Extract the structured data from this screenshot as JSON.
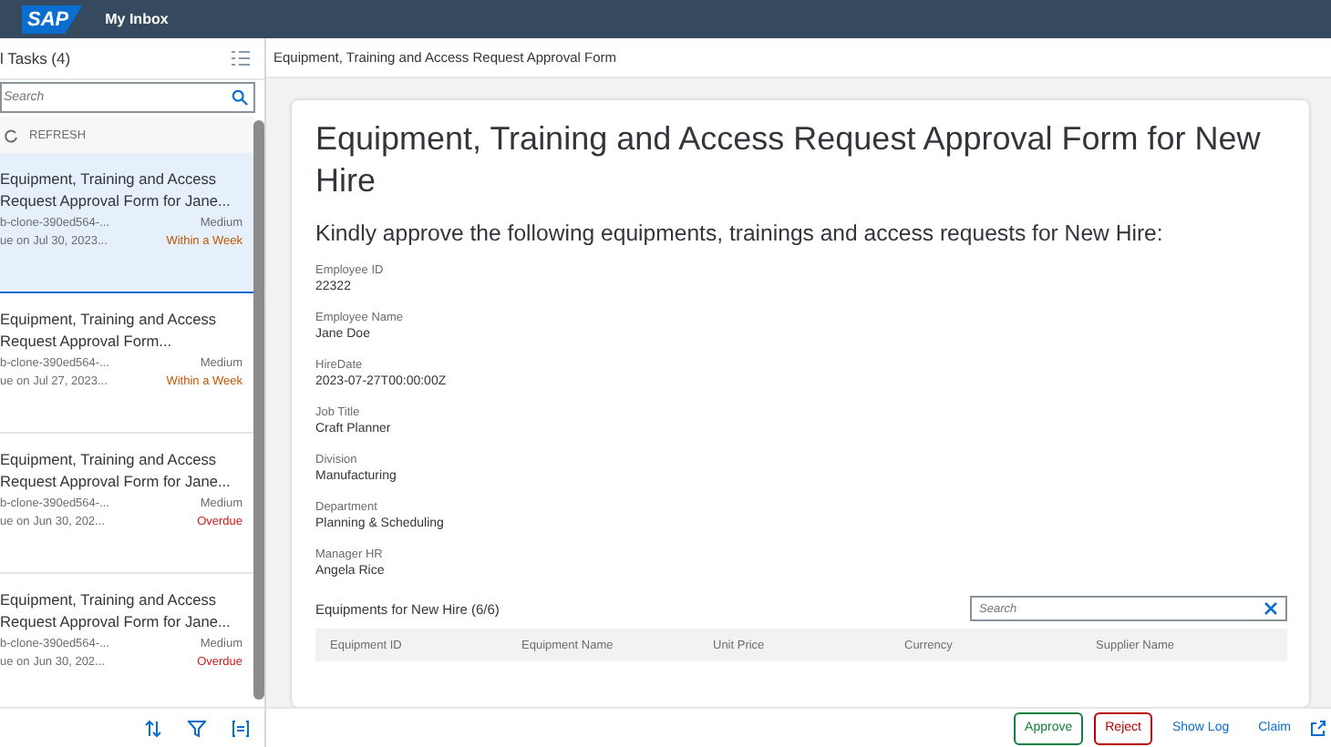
{
  "shell": {
    "logo": "SAP",
    "title": "My Inbox"
  },
  "task_list": {
    "title": "l Tasks (4)",
    "search": {
      "placeholder": "Search"
    },
    "refresh": "REFRESH",
    "items": [
      {
        "title": "Equipment, Training and Access Request Approval Form for Jane...",
        "id": "b-clone-390ed564-...",
        "priority": "Medium",
        "due": "ue on Jul 30, 2023...",
        "status": "Within a Week",
        "color": "#c35500",
        "selected": true
      },
      {
        "title": "Equipment, Training and Access Request Approval Form...",
        "id": "b-clone-390ed564-...",
        "priority": "Medium",
        "due": "ue on Jul 27, 2023...",
        "status": "Within a Week",
        "color": "#c35500",
        "selected": false
      },
      {
        "title": "Equipment, Training and Access Request Approval Form for Jane...",
        "id": "b-clone-390ed564-...",
        "priority": "Medium",
        "due": "ue on Jun 30, 202...",
        "status": "Overdue",
        "color": "#d01818",
        "selected": false
      },
      {
        "title": "Equipment, Training and Access Request Approval Form for Jane...",
        "id": "b-clone-390ed564-...",
        "priority": "Medium",
        "due": "ue on Jun 30, 202...",
        "status": "Overdue",
        "color": "#d01818",
        "selected": false
      }
    ]
  },
  "detail": {
    "header": "Equipment, Training and Access Request Approval Form",
    "title": "Equipment, Training and Access Request Approval Form for New Hire",
    "subtitle": "Kindly approve the following equipments, trainings and access requests for New Hire:",
    "fields": [
      {
        "label": "Employee ID",
        "value": "22322"
      },
      {
        "label": "Employee Name",
        "value": "Jane Doe"
      },
      {
        "label": "HireDate",
        "value": "2023-07-27T00:00:00Z"
      },
      {
        "label": "Job Title",
        "value": "Craft Planner"
      },
      {
        "label": "Division",
        "value": "Manufacturing"
      },
      {
        "label": "Department",
        "value": "Planning & Scheduling"
      },
      {
        "label": "Manager HR",
        "value": "Angela Rice"
      }
    ],
    "table": {
      "title": "Equipments for New Hire (6/6)",
      "search": {
        "placeholder": "Search"
      },
      "columns": [
        "Equipment ID",
        "Equipment Name",
        "Unit Price",
        "Currency",
        "Supplier Name"
      ]
    }
  },
  "footer": {
    "actions": [
      {
        "label": "Approve",
        "kind": "positive"
      },
      {
        "label": "Reject",
        "kind": "negative"
      },
      {
        "label": "Show Log",
        "kind": "link"
      },
      {
        "label": "Claim",
        "kind": "link"
      }
    ]
  }
}
